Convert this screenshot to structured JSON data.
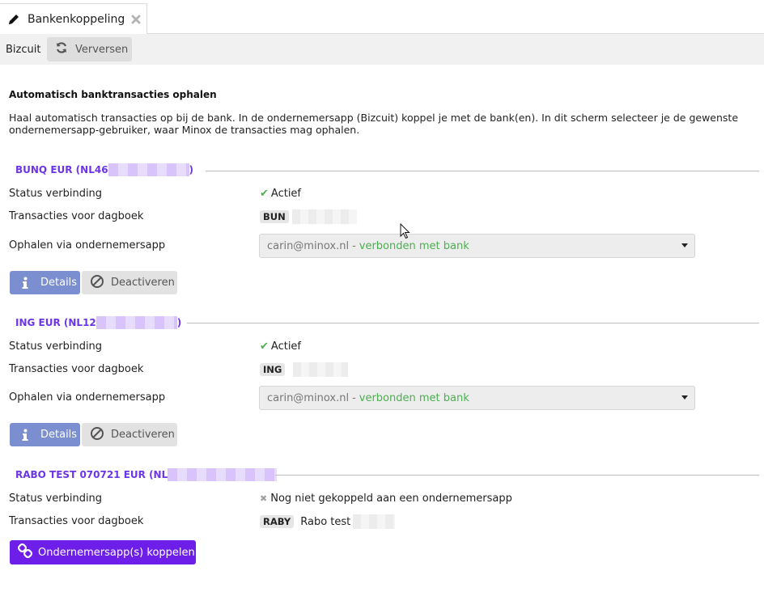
{
  "tab": {
    "title": "Bankenkoppeling"
  },
  "toolbar": {
    "app": "Bizcuit",
    "refresh_label": "Verversen"
  },
  "heading": "Automatisch banktransacties ophalen",
  "description": "Haal automatisch transacties op bij de bank. In de ondernemersapp (Bizcuit) koppel je met de bank(en). In dit scherm selecteer je de gewenste ondernemersapp-gebruiker, waar Minox de transacties mag ophalen.",
  "labels": {
    "status": "Status verbinding",
    "journal": "Transacties voor dagboek",
    "fetch": "Ophalen via ondernemersapp"
  },
  "accounts": [
    {
      "title_prefix": "BUNQ EUR (NL46",
      "title_suffix": ")",
      "status": "Actief",
      "journal_code": "BUN",
      "journal_name": "",
      "select_email": "carin@minox.nl",
      "select_sep": "-",
      "select_status": "verbonden met bank",
      "details_label": "Details",
      "deactivate_label": "Deactiveren"
    },
    {
      "title_prefix": "ING EUR (NL12",
      "title_suffix": ")",
      "status": "Actief",
      "journal_code": "ING",
      "journal_name": "",
      "select_email": "carin@minox.nl",
      "select_sep": "-",
      "select_status": "verbonden met bank",
      "details_label": "Details",
      "deactivate_label": "Deactiveren"
    },
    {
      "title_prefix": "RABO TEST 070721 EUR (NL",
      "title_suffix": "",
      "status": "Nog niet gekoppeld aan een ondernemersapp",
      "journal_code": "RABY",
      "journal_name": "Rabo test",
      "link_label": "Ondernemersapp(s) koppelen"
    }
  ],
  "colors": {
    "accent": "#6d35e8",
    "primary_button": "#6d1ee8",
    "details_button": "#7b8fd0",
    "success": "#4caf50"
  }
}
